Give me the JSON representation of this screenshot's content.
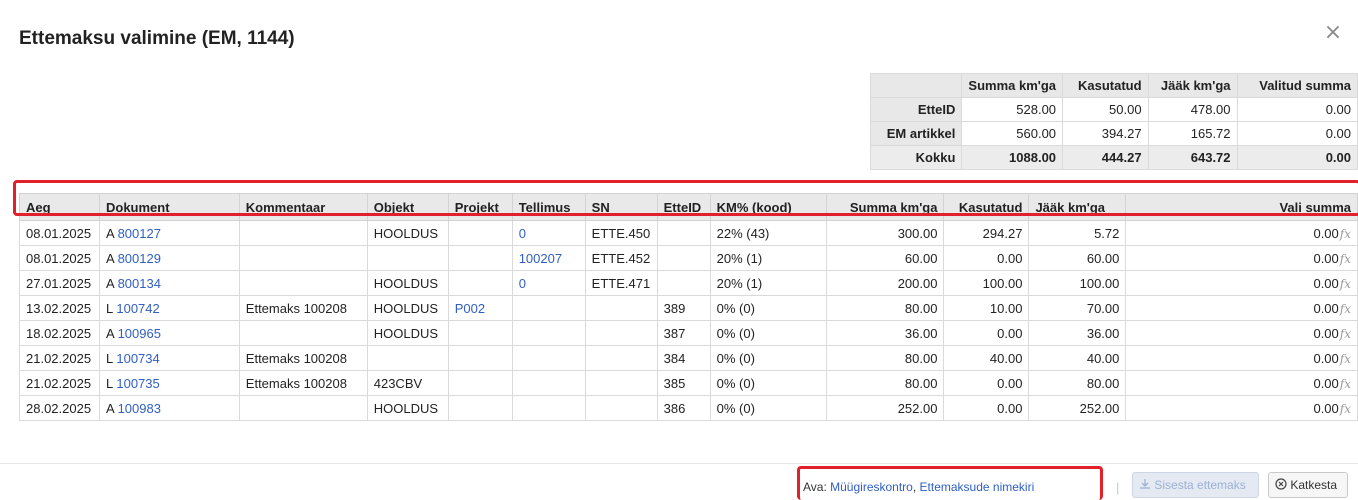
{
  "dialog": {
    "title": "Ettemaksu valimine (EM, 1144)",
    "close_symbol": "×"
  },
  "summary": {
    "headers": [
      "",
      "Summa km'ga",
      "Kasutatud",
      "Jääk km'ga",
      "Valitud summa"
    ],
    "rows": [
      {
        "label": "EtteID",
        "summa": "528.00",
        "kasutatud": "50.00",
        "jaak": "478.00",
        "valitud": "0.00"
      },
      {
        "label": "EM artikkel",
        "summa": "560.00",
        "kasutatud": "394.27",
        "jaak": "165.72",
        "valitud": "0.00"
      },
      {
        "label": "Kokku",
        "summa": "1088.00",
        "kasutatud": "444.27",
        "jaak": "643.72",
        "valitud": "0.00"
      }
    ]
  },
  "table": {
    "headers": {
      "aeg": "Aeg",
      "dokument": "Dokument",
      "kommentaar": "Kommentaar",
      "objekt": "Objekt",
      "projekt": "Projekt",
      "tellimus": "Tellimus",
      "sn": "SN",
      "etteid": "EtteID",
      "km": "KM% (kood)",
      "summa": "Summa km'ga",
      "kasutatud": "Kasutatud",
      "jaak": "Jääk km'ga",
      "vali": "Vali summa"
    },
    "rows": [
      {
        "aeg": "08.01.2025",
        "doc_type": "A",
        "doc_no": "800127",
        "kommentaar": "",
        "objekt": "HOOLDUS",
        "projekt": "",
        "tellimus": "0",
        "sn": "ETTE.450",
        "etteid": "",
        "km": "22% (43)",
        "summa": "300.00",
        "kasutatud": "294.27",
        "jaak": "5.72",
        "vali": "0.00"
      },
      {
        "aeg": "08.01.2025",
        "doc_type": "A",
        "doc_no": "800129",
        "kommentaar": "",
        "objekt": "",
        "projekt": "",
        "tellimus": "100207",
        "sn": "ETTE.452",
        "etteid": "",
        "km": "20% (1)",
        "summa": "60.00",
        "kasutatud": "0.00",
        "jaak": "60.00",
        "vali": "0.00"
      },
      {
        "aeg": "27.01.2025",
        "doc_type": "A",
        "doc_no": "800134",
        "kommentaar": "",
        "objekt": "HOOLDUS",
        "projekt": "",
        "tellimus": "0",
        "sn": "ETTE.471",
        "etteid": "",
        "km": "20% (1)",
        "summa": "200.00",
        "kasutatud": "100.00",
        "jaak": "100.00",
        "vali": "0.00"
      },
      {
        "aeg": "13.02.2025",
        "doc_type": "L",
        "doc_no": "100742",
        "kommentaar": "Ettemaks 100208",
        "objekt": "HOOLDUS",
        "projekt": "P002",
        "tellimus": "",
        "sn": "",
        "etteid": "389",
        "km": "0% (0)",
        "summa": "80.00",
        "kasutatud": "10.00",
        "jaak": "70.00",
        "vali": "0.00"
      },
      {
        "aeg": "18.02.2025",
        "doc_type": "A",
        "doc_no": "100965",
        "kommentaar": "",
        "objekt": "HOOLDUS",
        "projekt": "",
        "tellimus": "",
        "sn": "",
        "etteid": "387",
        "km": "0% (0)",
        "summa": "36.00",
        "kasutatud": "0.00",
        "jaak": "36.00",
        "vali": "0.00"
      },
      {
        "aeg": "21.02.2025",
        "doc_type": "L",
        "doc_no": "100734",
        "kommentaar": "Ettemaks 100208",
        "objekt": "",
        "projekt": "",
        "tellimus": "",
        "sn": "",
        "etteid": "384",
        "km": "0% (0)",
        "summa": "80.00",
        "kasutatud": "40.00",
        "jaak": "40.00",
        "vali": "0.00"
      },
      {
        "aeg": "21.02.2025",
        "doc_type": "L",
        "doc_no": "100735",
        "kommentaar": "Ettemaks 100208",
        "objekt": "423CBV",
        "projekt": "",
        "tellimus": "",
        "sn": "",
        "etteid": "385",
        "km": "0% (0)",
        "summa": "80.00",
        "kasutatud": "0.00",
        "jaak": "80.00",
        "vali": "0.00"
      },
      {
        "aeg": "28.02.2025",
        "doc_type": "A",
        "doc_no": "100983",
        "kommentaar": "",
        "objekt": "HOOLDUS",
        "projekt": "",
        "tellimus": "",
        "sn": "",
        "etteid": "386",
        "km": "0% (0)",
        "summa": "252.00",
        "kasutatud": "0.00",
        "jaak": "252.00",
        "vali": "0.00"
      }
    ],
    "fx_label": "fx"
  },
  "footer": {
    "ava_prefix": "Ava:",
    "link_muugireskontro": "Müügireskontro",
    "link_separator": ", ",
    "link_ettemaksude": "Ettemaksude nimekiri",
    "divider": "|",
    "insert_label": "Sisesta ettemaks",
    "cancel_label": "Katkesta",
    "insert_icon": "download-icon",
    "cancel_icon": "circle-x-icon"
  },
  "colors": {
    "link": "#2f5fc4",
    "highlight": "#e0202a",
    "header_bg": "#e9e9e9"
  }
}
